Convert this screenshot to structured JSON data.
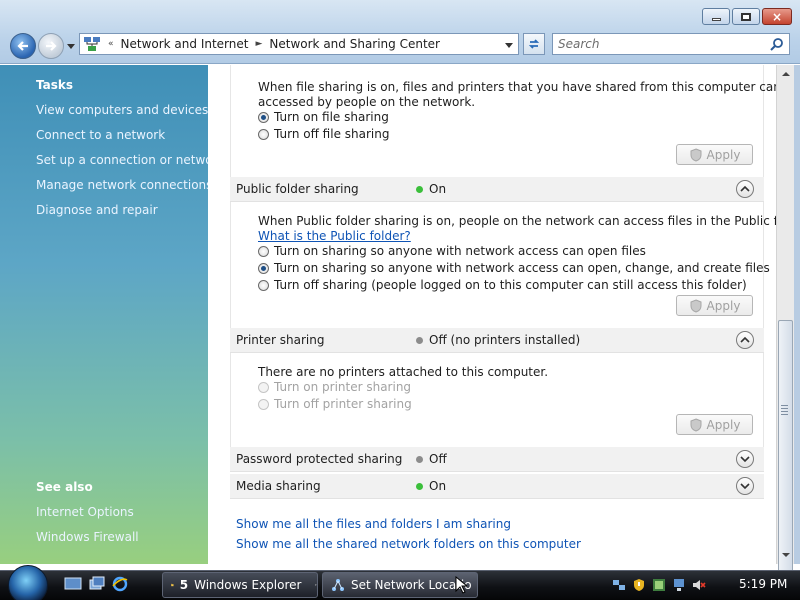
{
  "window": {
    "breadcrumb": [
      "Network and Internet",
      "Network and Sharing Center"
    ],
    "search_placeholder": "Search",
    "close_glyph": "×"
  },
  "tasks": {
    "heading": "Tasks",
    "items": [
      "View computers and devices",
      "Connect to a network",
      "Set up a connection or network",
      "Manage network connections",
      "Diagnose and repair"
    ],
    "see_also_heading": "See also",
    "see_also": [
      "Internet Options",
      "Windows Firewall"
    ]
  },
  "file_sharing": {
    "description_line1": "When file sharing is on, files and printers that you have shared from this computer can be",
    "description_line2": "accessed by people on the network.",
    "options": [
      "Turn on file sharing",
      "Turn off file sharing"
    ],
    "selected": 0,
    "apply_label": "Apply"
  },
  "public_folder": {
    "title": "Public folder sharing",
    "state": "On",
    "status_color": "#3bbf3b",
    "description": "When Public folder sharing is on, people on the network can access files in the Public folder.",
    "help_link": "What is the Public folder?",
    "options": [
      "Turn on sharing so anyone with network access can open files",
      "Turn on sharing so anyone with network access can open, change, and create files",
      "Turn off sharing (people logged on to this computer can still access this folder)"
    ],
    "selected": 1,
    "apply_label": "Apply"
  },
  "printer_sharing": {
    "title": "Printer sharing",
    "state": "Off (no printers installed)",
    "status_color": "#8c8c8c",
    "description": "There are no printers attached to this computer.",
    "options": [
      "Turn on printer sharing",
      "Turn off printer sharing"
    ],
    "apply_label": "Apply"
  },
  "password_sharing": {
    "title": "Password protected sharing",
    "state": "Off",
    "status_color": "#8c8c8c"
  },
  "media_sharing": {
    "title": "Media sharing",
    "state": "On",
    "status_color": "#3bbf3b"
  },
  "links": {
    "show_files": "Show me all the files and folders I am sharing",
    "show_folders": "Show me all the shared network folders on this computer"
  },
  "taskbar": {
    "explorer_count": "5",
    "explorer_label": "Windows Explorer",
    "network_label": "Set Network Locatio",
    "clock": "5:19 PM"
  }
}
